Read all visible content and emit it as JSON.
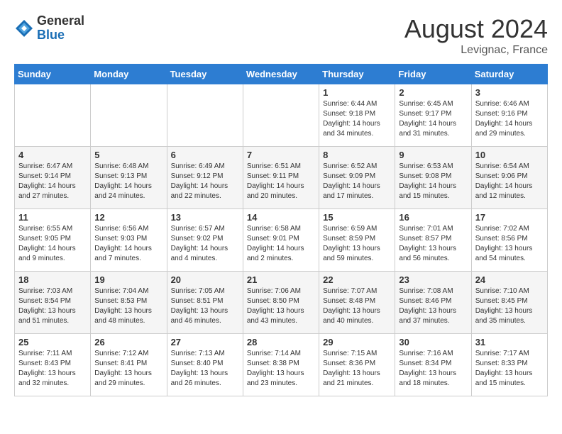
{
  "logo": {
    "general": "General",
    "blue": "Blue"
  },
  "title": {
    "month_year": "August 2024",
    "location": "Levignac, France"
  },
  "weekdays": [
    "Sunday",
    "Monday",
    "Tuesday",
    "Wednesday",
    "Thursday",
    "Friday",
    "Saturday"
  ],
  "weeks": [
    [
      {
        "day": "",
        "info": ""
      },
      {
        "day": "",
        "info": ""
      },
      {
        "day": "",
        "info": ""
      },
      {
        "day": "",
        "info": ""
      },
      {
        "day": "1",
        "info": "Sunrise: 6:44 AM\nSunset: 9:18 PM\nDaylight: 14 hours\nand 34 minutes."
      },
      {
        "day": "2",
        "info": "Sunrise: 6:45 AM\nSunset: 9:17 PM\nDaylight: 14 hours\nand 31 minutes."
      },
      {
        "day": "3",
        "info": "Sunrise: 6:46 AM\nSunset: 9:16 PM\nDaylight: 14 hours\nand 29 minutes."
      }
    ],
    [
      {
        "day": "4",
        "info": "Sunrise: 6:47 AM\nSunset: 9:14 PM\nDaylight: 14 hours\nand 27 minutes."
      },
      {
        "day": "5",
        "info": "Sunrise: 6:48 AM\nSunset: 9:13 PM\nDaylight: 14 hours\nand 24 minutes."
      },
      {
        "day": "6",
        "info": "Sunrise: 6:49 AM\nSunset: 9:12 PM\nDaylight: 14 hours\nand 22 minutes."
      },
      {
        "day": "7",
        "info": "Sunrise: 6:51 AM\nSunset: 9:11 PM\nDaylight: 14 hours\nand 20 minutes."
      },
      {
        "day": "8",
        "info": "Sunrise: 6:52 AM\nSunset: 9:09 PM\nDaylight: 14 hours\nand 17 minutes."
      },
      {
        "day": "9",
        "info": "Sunrise: 6:53 AM\nSunset: 9:08 PM\nDaylight: 14 hours\nand 15 minutes."
      },
      {
        "day": "10",
        "info": "Sunrise: 6:54 AM\nSunset: 9:06 PM\nDaylight: 14 hours\nand 12 minutes."
      }
    ],
    [
      {
        "day": "11",
        "info": "Sunrise: 6:55 AM\nSunset: 9:05 PM\nDaylight: 14 hours\nand 9 minutes."
      },
      {
        "day": "12",
        "info": "Sunrise: 6:56 AM\nSunset: 9:03 PM\nDaylight: 14 hours\nand 7 minutes."
      },
      {
        "day": "13",
        "info": "Sunrise: 6:57 AM\nSunset: 9:02 PM\nDaylight: 14 hours\nand 4 minutes."
      },
      {
        "day": "14",
        "info": "Sunrise: 6:58 AM\nSunset: 9:01 PM\nDaylight: 14 hours\nand 2 minutes."
      },
      {
        "day": "15",
        "info": "Sunrise: 6:59 AM\nSunset: 8:59 PM\nDaylight: 13 hours\nand 59 minutes."
      },
      {
        "day": "16",
        "info": "Sunrise: 7:01 AM\nSunset: 8:57 PM\nDaylight: 13 hours\nand 56 minutes."
      },
      {
        "day": "17",
        "info": "Sunrise: 7:02 AM\nSunset: 8:56 PM\nDaylight: 13 hours\nand 54 minutes."
      }
    ],
    [
      {
        "day": "18",
        "info": "Sunrise: 7:03 AM\nSunset: 8:54 PM\nDaylight: 13 hours\nand 51 minutes."
      },
      {
        "day": "19",
        "info": "Sunrise: 7:04 AM\nSunset: 8:53 PM\nDaylight: 13 hours\nand 48 minutes."
      },
      {
        "day": "20",
        "info": "Sunrise: 7:05 AM\nSunset: 8:51 PM\nDaylight: 13 hours\nand 46 minutes."
      },
      {
        "day": "21",
        "info": "Sunrise: 7:06 AM\nSunset: 8:50 PM\nDaylight: 13 hours\nand 43 minutes."
      },
      {
        "day": "22",
        "info": "Sunrise: 7:07 AM\nSunset: 8:48 PM\nDaylight: 13 hours\nand 40 minutes."
      },
      {
        "day": "23",
        "info": "Sunrise: 7:08 AM\nSunset: 8:46 PM\nDaylight: 13 hours\nand 37 minutes."
      },
      {
        "day": "24",
        "info": "Sunrise: 7:10 AM\nSunset: 8:45 PM\nDaylight: 13 hours\nand 35 minutes."
      }
    ],
    [
      {
        "day": "25",
        "info": "Sunrise: 7:11 AM\nSunset: 8:43 PM\nDaylight: 13 hours\nand 32 minutes."
      },
      {
        "day": "26",
        "info": "Sunrise: 7:12 AM\nSunset: 8:41 PM\nDaylight: 13 hours\nand 29 minutes."
      },
      {
        "day": "27",
        "info": "Sunrise: 7:13 AM\nSunset: 8:40 PM\nDaylight: 13 hours\nand 26 minutes."
      },
      {
        "day": "28",
        "info": "Sunrise: 7:14 AM\nSunset: 8:38 PM\nDaylight: 13 hours\nand 23 minutes."
      },
      {
        "day": "29",
        "info": "Sunrise: 7:15 AM\nSunset: 8:36 PM\nDaylight: 13 hours\nand 21 minutes."
      },
      {
        "day": "30",
        "info": "Sunrise: 7:16 AM\nSunset: 8:34 PM\nDaylight: 13 hours\nand 18 minutes."
      },
      {
        "day": "31",
        "info": "Sunrise: 7:17 AM\nSunset: 8:33 PM\nDaylight: 13 hours\nand 15 minutes."
      }
    ]
  ]
}
